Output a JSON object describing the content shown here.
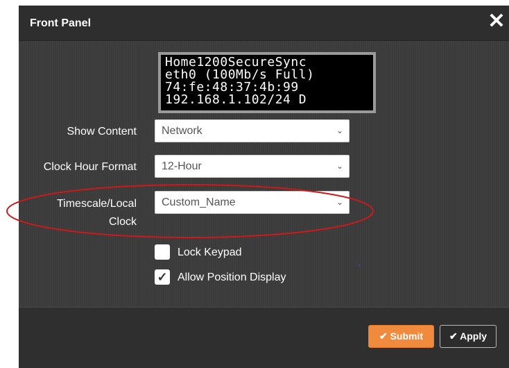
{
  "dialog": {
    "title": "Front Panel",
    "close_symbol": "✕"
  },
  "lcd": {
    "lines": [
      "Home1200SecureSync",
      "eth0 (100Mb/s Full)",
      "74:fe:48:37:4b:99",
      "192.168.1.102/24 D"
    ]
  },
  "form": {
    "show_content": {
      "label": "Show Content",
      "value": "Network"
    },
    "clock_hour_format": {
      "label": "Clock Hour Format",
      "value": "12-Hour"
    },
    "timescale": {
      "label_line1": "Timescale/Local",
      "label_line2": "Clock",
      "value": "Custom_Name"
    },
    "lock_keypad": {
      "label": "Lock Keypad",
      "checked": false
    },
    "allow_position": {
      "label": "Allow Position Display",
      "checked": true,
      "mark": "✓"
    }
  },
  "footer": {
    "submit_label": "✔ Submit",
    "apply_label": "✔ Apply"
  },
  "colors": {
    "submit": "#f08a3c",
    "annotation": "#cc1a1a",
    "dialog_bg": "#3b3b3b"
  },
  "icons": {
    "close": "close-icon",
    "chevron": "chevron-down-icon",
    "check": "check-icon"
  }
}
